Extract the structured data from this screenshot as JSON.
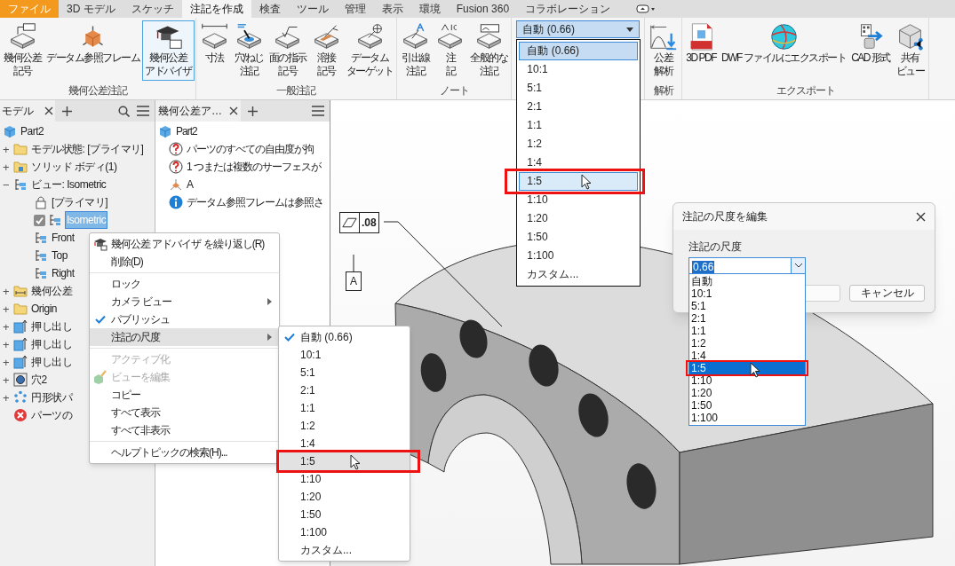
{
  "ribbon_tabs": [
    {
      "label": "ファイル",
      "kind": "file",
      "selected": false
    },
    {
      "label": "3D モデル",
      "kind": "tab",
      "selected": false
    },
    {
      "label": "スケッチ",
      "kind": "tab",
      "selected": false
    },
    {
      "label": "注記を作成",
      "kind": "tab",
      "selected": true
    },
    {
      "label": "検査",
      "kind": "tab",
      "selected": false
    },
    {
      "label": "ツール",
      "kind": "tab",
      "selected": false
    },
    {
      "label": "管理",
      "kind": "tab",
      "selected": false
    },
    {
      "label": "表示",
      "kind": "tab",
      "selected": false
    },
    {
      "label": "環境",
      "kind": "tab",
      "selected": false
    },
    {
      "label": "Fusion 360",
      "kind": "tab",
      "selected": false
    },
    {
      "label": "コラボレーション",
      "kind": "tab",
      "selected": false
    }
  ],
  "ribbon_groups": [
    {
      "kind": "buttons",
      "label": "幾何公差注記",
      "buttons": [
        {
          "lines": [
            "幾何公差",
            "記号"
          ],
          "active": false
        },
        {
          "lines": [
            "データム参照フレーム"
          ],
          "active": false
        },
        {
          "lines": [
            "幾何公差",
            "アドバイザ"
          ],
          "active": true
        }
      ]
    },
    {
      "kind": "buttons",
      "label": "一般注記",
      "buttons": [
        {
          "lines": [
            "寸法"
          ],
          "active": false
        },
        {
          "lines": [
            "穴/ねじ",
            "注記"
          ],
          "active": false
        },
        {
          "lines": [
            "面の指示",
            "記号"
          ],
          "active": false
        },
        {
          "lines": [
            "溶接",
            "記号"
          ],
          "active": false
        },
        {
          "lines": [
            "データム",
            "ターゲット"
          ],
          "active": false
        }
      ]
    },
    {
      "kind": "buttons",
      "label": "ノート",
      "buttons": [
        {
          "lines": [
            "引出線",
            "注記"
          ],
          "active": false
        },
        {
          "lines": [
            "注",
            "記"
          ],
          "active": false
        },
        {
          "lines": [
            "全般的な",
            "注記"
          ],
          "active": false
        }
      ]
    },
    {
      "kind": "combo",
      "value": "自動 (0.66)",
      "options": [
        {
          "label": "自動 (0.66)",
          "selected": true,
          "hovered": false
        },
        {
          "label": "10:1",
          "selected": false,
          "hovered": false
        },
        {
          "label": "5:1",
          "selected": false,
          "hovered": false
        },
        {
          "label": "2:1",
          "selected": false,
          "hovered": false
        },
        {
          "label": "1:1",
          "selected": false,
          "hovered": false
        },
        {
          "label": "1:2",
          "selected": false,
          "hovered": false
        },
        {
          "label": "1:4",
          "selected": false,
          "hovered": false
        },
        {
          "label": "1:5",
          "selected": false,
          "hovered": true
        },
        {
          "label": "1:10",
          "selected": false,
          "hovered": false
        },
        {
          "label": "1:20",
          "selected": false,
          "hovered": false
        },
        {
          "label": "1:50",
          "selected": false,
          "hovered": false
        },
        {
          "label": "1:100",
          "selected": false,
          "hovered": false
        },
        {
          "label": "カスタム...",
          "selected": false,
          "hovered": false
        }
      ]
    },
    {
      "kind": "buttons",
      "label": "解析",
      "buttons": [
        {
          "lines": [
            "公差",
            "解析"
          ],
          "active": false
        }
      ]
    },
    {
      "kind": "buttons",
      "label": "エクスポート",
      "buttons": [
        {
          "lines": [
            "3D PDF"
          ],
          "active": false
        },
        {
          "lines": [
            "DWF ファイルにエクスポート"
          ],
          "active": false
        },
        {
          "lines": [
            "CAD 形式"
          ],
          "active": false
        },
        {
          "lines": [
            "共有",
            "ビュー"
          ],
          "active": false
        }
      ]
    }
  ],
  "model_browser": {
    "tab": "モデル",
    "tree": [
      {
        "kind": "part",
        "label": "Part2",
        "selected": false,
        "children": [
          {
            "kind": "folder",
            "label": "モデル状態: [プライマリ]",
            "expander": "+",
            "selected": false
          },
          {
            "kind": "body-folder",
            "label": "ソリッド ボディ(1)",
            "expander": "+",
            "selected": false
          },
          {
            "kind": "view",
            "label": "ビュー: Isometric",
            "expander": "−",
            "selected": false,
            "children": [
              {
                "kind": "lock",
                "label": "[プライマリ]",
                "selected": false
              },
              {
                "kind": "view",
                "label": "Isometric",
                "checked": true,
                "selected": true
              },
              {
                "kind": "view",
                "label": "Front",
                "selected": false
              },
              {
                "kind": "view",
                "label": "Top",
                "selected": false
              },
              {
                "kind": "view",
                "label": "Right",
                "selected": false
              }
            ]
          },
          {
            "kind": "annotation-folder",
            "label": "幾何公差",
            "expander": "+",
            "selected": false
          },
          {
            "kind": "folder",
            "label": "Origin",
            "expander": "+",
            "selected": false
          },
          {
            "kind": "extrusion",
            "label": "押し出し",
            "expander": "+",
            "selected": false
          },
          {
            "kind": "extrusion",
            "label": "押し出し",
            "expander": "+",
            "selected": false
          },
          {
            "kind": "extrusion",
            "label": "押し出し",
            "expander": "+",
            "selected": false
          },
          {
            "kind": "hole",
            "label": "穴2",
            "expander": "+",
            "selected": false
          },
          {
            "kind": "pattern",
            "label": "円形状パ",
            "expander": "+",
            "selected": false
          },
          {
            "kind": "error",
            "label": "パーツの",
            "selected": false
          }
        ]
      }
    ]
  },
  "advisor_browser": {
    "tab": "幾何公差ア…",
    "tree": [
      {
        "kind": "part",
        "label": "Part2",
        "selected": false,
        "children": [
          {
            "kind": "warning",
            "label": "パーツのすべての自由度が拘",
            "selected": false
          },
          {
            "kind": "warning",
            "label": "1 つまたは複数のサーフェスが",
            "selected": false
          },
          {
            "kind": "datum",
            "label": "A",
            "selected": false
          },
          {
            "kind": "info",
            "label": "データム参照フレームは参照さ",
            "selected": false
          }
        ]
      }
    ]
  },
  "context_menu": {
    "items": [
      {
        "kind": "advisor",
        "label": "幾何公差 アドバイザ を繰り返し(R)",
        "checked": false,
        "submenu": false,
        "disabled": false,
        "hovered": false
      },
      {
        "kind": "command",
        "label": "削除(D)",
        "checked": false,
        "submenu": false,
        "disabled": false,
        "hovered": false
      },
      {
        "kind": "separator"
      },
      {
        "kind": "command",
        "label": "ロック",
        "checked": false,
        "submenu": false,
        "disabled": false,
        "hovered": false
      },
      {
        "kind": "command",
        "label": "カメラ ビュー",
        "checked": false,
        "submenu": true,
        "disabled": false,
        "hovered": false
      },
      {
        "kind": "command",
        "label": "パブリッシュ",
        "checked": true,
        "submenu": false,
        "disabled": false,
        "hovered": false
      },
      {
        "kind": "command",
        "label": "注記の尺度",
        "checked": false,
        "submenu": true,
        "disabled": false,
        "hovered": true
      },
      {
        "kind": "separator"
      },
      {
        "kind": "command",
        "label": "アクティブ化",
        "checked": false,
        "submenu": false,
        "disabled": true,
        "hovered": false
      },
      {
        "kind": "edit-view",
        "label": "ビューを編集",
        "checked": false,
        "submenu": false,
        "disabled": true,
        "hovered": false
      },
      {
        "kind": "command",
        "label": "コピー",
        "checked": false,
        "submenu": false,
        "disabled": false,
        "hovered": false
      },
      {
        "kind": "command",
        "label": "すべて表示",
        "checked": false,
        "submenu": false,
        "disabled": false,
        "hovered": false
      },
      {
        "kind": "command",
        "label": "すべて非表示",
        "checked": false,
        "submenu": false,
        "disabled": false,
        "hovered": false
      },
      {
        "kind": "separator"
      },
      {
        "kind": "command",
        "label": "ヘルプトピックの検索(H)...",
        "checked": false,
        "submenu": false,
        "disabled": false,
        "hovered": false
      }
    ]
  },
  "scale_submenu": {
    "items": [
      {
        "label": "自動 (0.66)",
        "checked": true,
        "hovered": false
      },
      {
        "label": "10:1",
        "checked": false,
        "hovered": false
      },
      {
        "label": "5:1",
        "checked": false,
        "hovered": false
      },
      {
        "label": "2:1",
        "checked": false,
        "hovered": false
      },
      {
        "label": "1:1",
        "checked": false,
        "hovered": false
      },
      {
        "label": "1:2",
        "checked": false,
        "hovered": false
      },
      {
        "label": "1:4",
        "checked": false,
        "hovered": false
      },
      {
        "label": "1:5",
        "checked": false,
        "hovered": true
      },
      {
        "label": "1:10",
        "checked": false,
        "hovered": false
      },
      {
        "label": "1:20",
        "checked": false,
        "hovered": false
      },
      {
        "label": "1:50",
        "checked": false,
        "hovered": false
      },
      {
        "label": "1:100",
        "checked": false,
        "hovered": false
      },
      {
        "label": "カスタム...",
        "checked": false,
        "hovered": false
      }
    ]
  },
  "canvas": {
    "feature_control_frame": {
      "tolerance": ".08",
      "datum": "A"
    }
  },
  "dialog": {
    "title": "注記の尺度を編集",
    "field_label": "注記の尺度",
    "value": "0.66",
    "options": [
      {
        "label": "自動",
        "selected": false
      },
      {
        "label": "10:1",
        "selected": false
      },
      {
        "label": "5:1",
        "selected": false
      },
      {
        "label": "2:1",
        "selected": false
      },
      {
        "label": "1:1",
        "selected": false
      },
      {
        "label": "1:2",
        "selected": false
      },
      {
        "label": "1:4",
        "selected": false
      },
      {
        "label": "1:5",
        "selected": true
      },
      {
        "label": "1:10",
        "selected": false
      },
      {
        "label": "1:20",
        "selected": false
      },
      {
        "label": "1:50",
        "selected": false
      },
      {
        "label": "1:100",
        "selected": false
      }
    ],
    "buttons": [
      "キャンセル"
    ]
  }
}
